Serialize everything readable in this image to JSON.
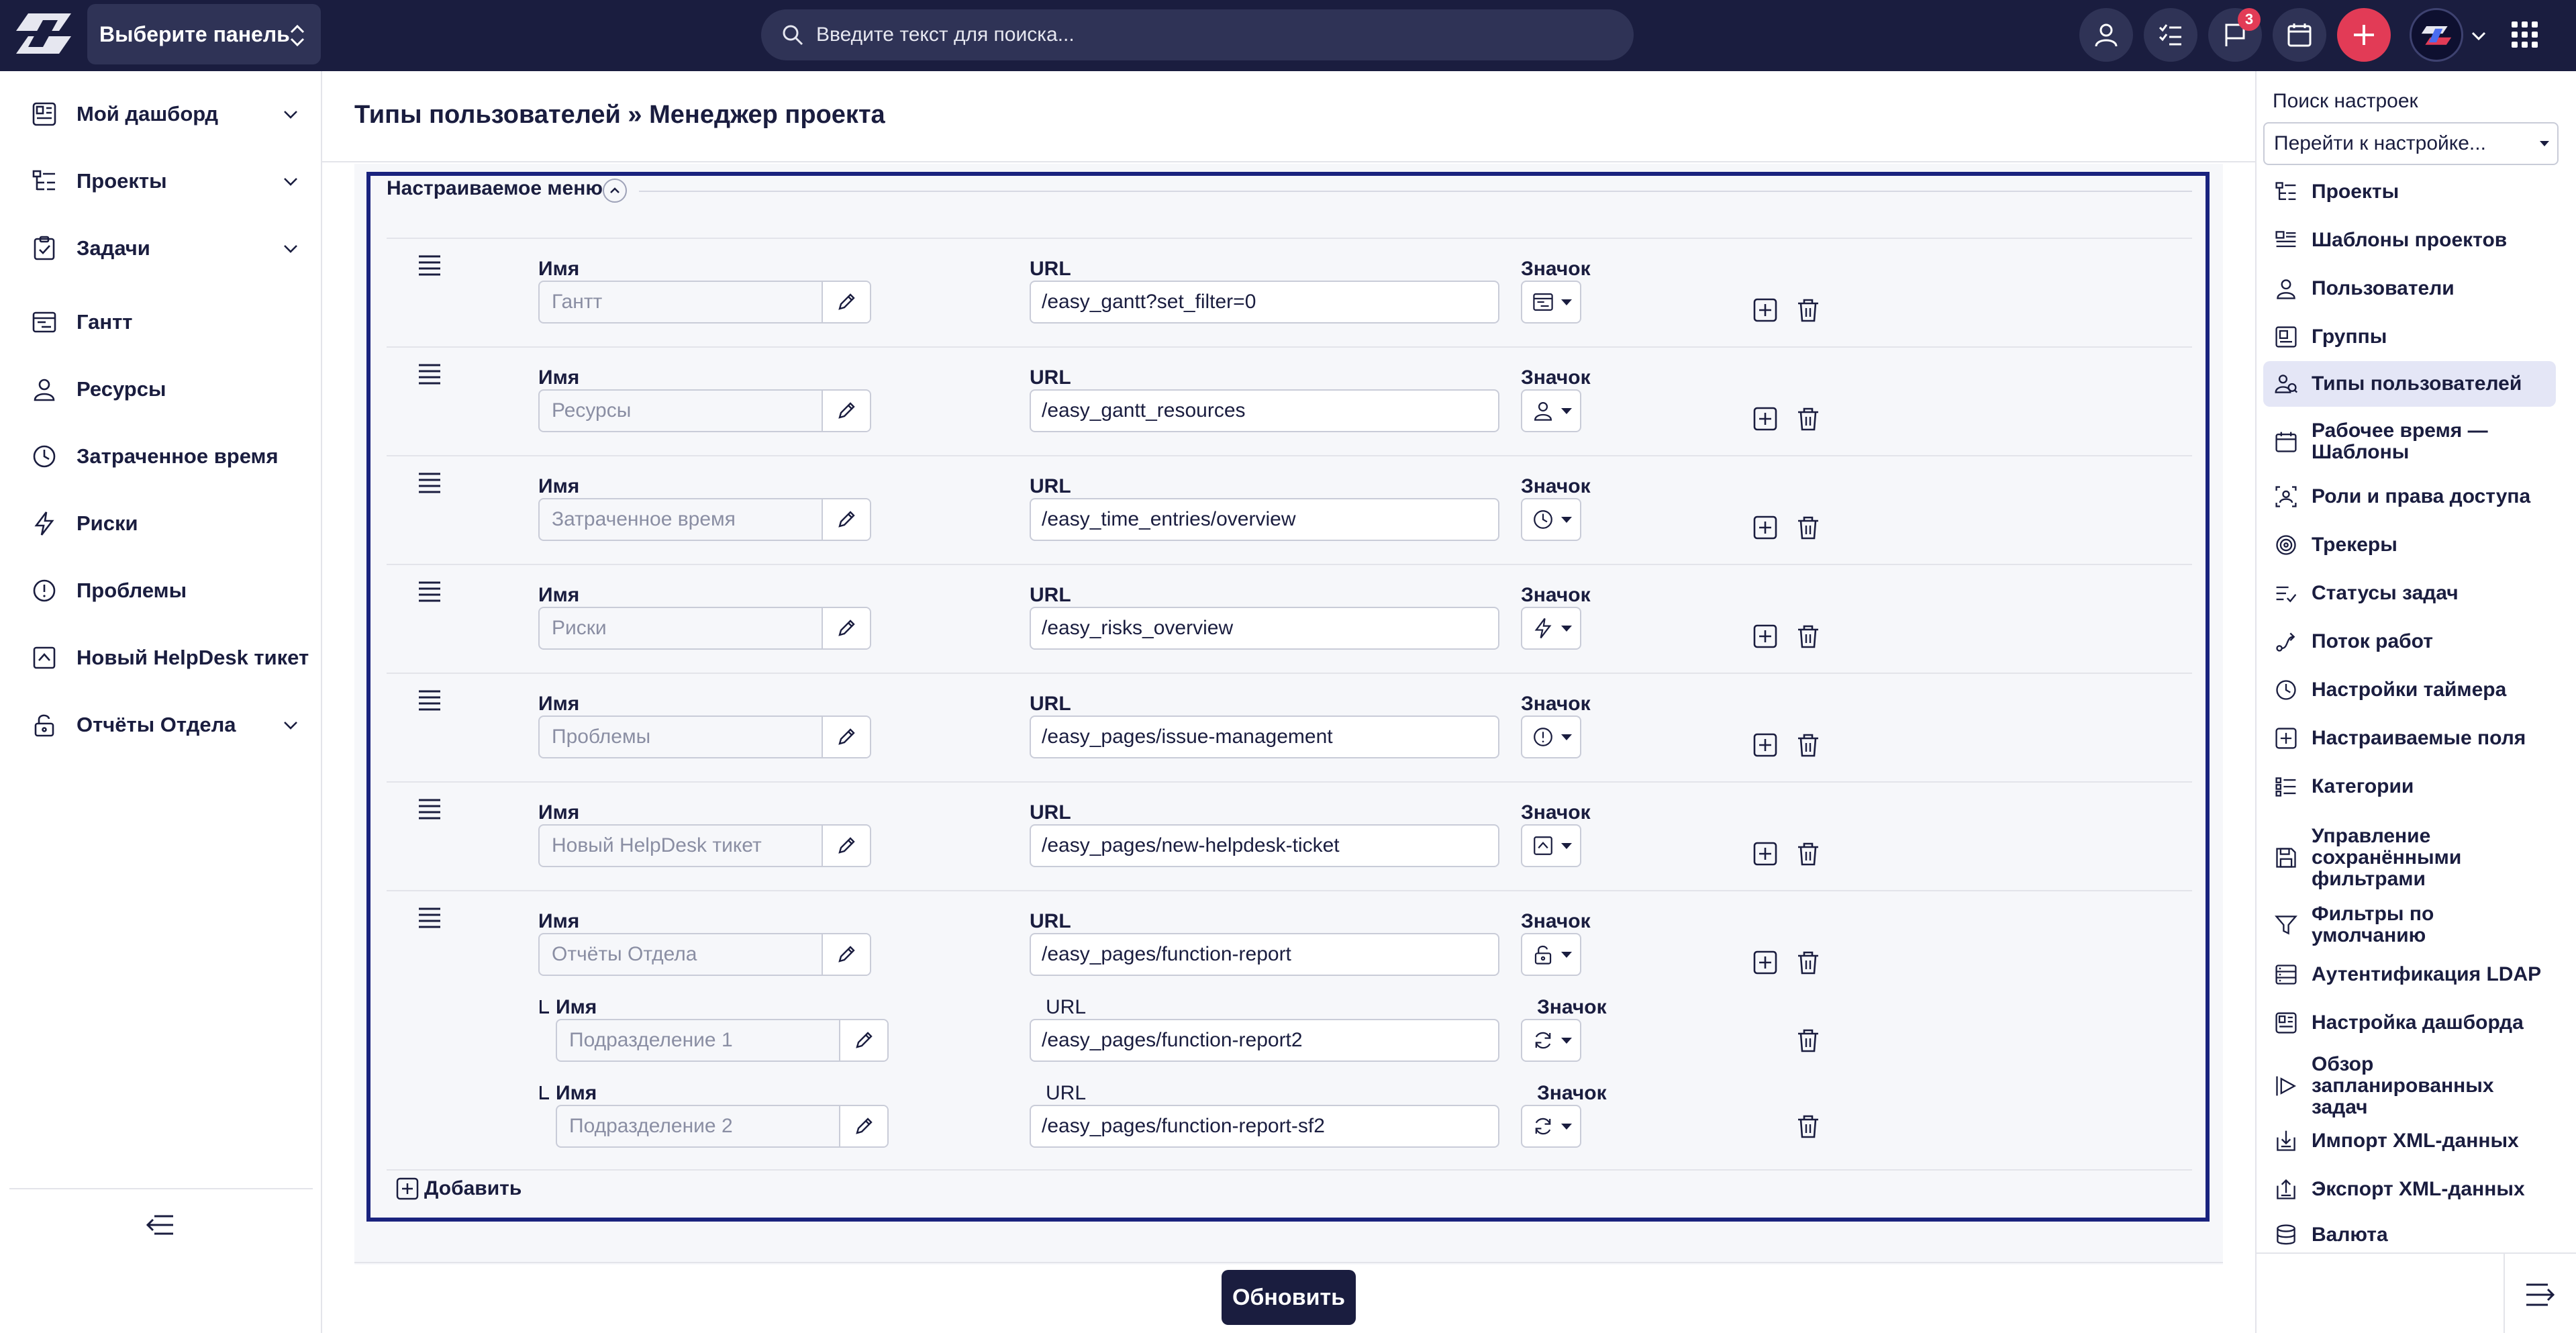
{
  "topbar": {
    "panel_select_label": "Выберите панель",
    "search_placeholder": "Введите текст для поиска...",
    "notifications_count": "3"
  },
  "sidebar": {
    "items": [
      {
        "label": "Мой дашборд",
        "icon": "dashboard-icon",
        "chevron": true
      },
      {
        "label": "Проекты",
        "icon": "projects-icon",
        "chevron": true
      },
      {
        "label": "Задачи",
        "icon": "tasks-icon",
        "chevron": true
      },
      {
        "label": "Гантт",
        "icon": "gantt-icon",
        "chevron": false
      },
      {
        "label": "Ресурсы",
        "icon": "user-icon",
        "chevron": false
      },
      {
        "label": "Затраченное время",
        "icon": "clock-icon",
        "chevron": false
      },
      {
        "label": "Риски",
        "icon": "lightning-icon",
        "chevron": false
      },
      {
        "label": "Проблемы",
        "icon": "alert-icon",
        "chevron": false
      },
      {
        "label": "Новый HelpDesk тикет",
        "icon": "helpdesk-icon",
        "chevron": false
      },
      {
        "label": "Отчёты Отдела",
        "icon": "lock-open-icon",
        "chevron": true
      }
    ]
  },
  "page": {
    "title": "Типы пользователей » Менеджер проекта",
    "section_title": "Настраиваемое меню",
    "name_label": "Имя",
    "url_label": "URL",
    "icon_label": "Значок",
    "add_label": "Добавить",
    "update_label": "Обновить"
  },
  "menu_rows": [
    {
      "name": "Гантт",
      "url": "/easy_gantt?set_filter=0",
      "icon": "gantt-icon"
    },
    {
      "name": "Ресурсы",
      "url": "/easy_gantt_resources",
      "icon": "user-icon"
    },
    {
      "name": "Затраченное время",
      "url": "/easy_time_entries/overview",
      "icon": "clock-icon"
    },
    {
      "name": "Риски",
      "url": "/easy_risks_overview",
      "icon": "lightning-icon"
    },
    {
      "name": "Проблемы",
      "url": "/easy_pages/issue-management",
      "icon": "alert-icon"
    },
    {
      "name": "Новый HelpDesk тикет",
      "url": "/easy_pages/new-helpdesk-ticket",
      "icon": "helpdesk-icon"
    },
    {
      "name": "Отчёты Отдела",
      "url": "/easy_pages/function-report",
      "icon": "lock-open-icon",
      "children": [
        {
          "name": "Подразделение 1",
          "url": "/easy_pages/function-report2",
          "icon": "refresh-icon"
        },
        {
          "name": "Подразделение 2",
          "url": "/easy_pages/function-report-sf2",
          "icon": "refresh-icon"
        }
      ]
    }
  ],
  "right_panel": {
    "search_title": "Поиск настроек",
    "select_value": "Перейти к настройке...",
    "items": [
      {
        "label": "Проекты",
        "icon": "projects-icon"
      },
      {
        "label": "Шаблоны проектов",
        "icon": "template-icon"
      },
      {
        "label": "Пользователи",
        "icon": "user-icon"
      },
      {
        "label": "Группы",
        "icon": "groups-icon"
      },
      {
        "label": "Типы пользователей",
        "icon": "user-types-icon",
        "active": true
      },
      {
        "label": "Рабочее время — Шаблоны",
        "icon": "calendar-icon"
      },
      {
        "label": "Роли и права доступа",
        "icon": "roles-icon"
      },
      {
        "label": "Трекеры",
        "icon": "tracker-icon"
      },
      {
        "label": "Статусы задач",
        "icon": "status-icon"
      },
      {
        "label": "Поток работ",
        "icon": "workflow-icon"
      },
      {
        "label": "Настройки таймера",
        "icon": "clock-icon"
      },
      {
        "label": "Настраиваемые поля",
        "icon": "plus-box-icon"
      },
      {
        "label": "Категории",
        "icon": "categories-icon"
      },
      {
        "label": "Управление сохранёнными фильтрами",
        "icon": "save-icon"
      },
      {
        "label": "Фильтры по умолчанию",
        "icon": "filter-icon"
      },
      {
        "label": "Аутентификация LDAP",
        "icon": "ldap-icon"
      },
      {
        "label": "Настройка дашборда",
        "icon": "dashboard-icon"
      },
      {
        "label": "Обзор запланированных задач",
        "icon": "play-icon"
      },
      {
        "label": "Импорт XML-данных",
        "icon": "import-icon"
      },
      {
        "label": "Экспорт XML-данных",
        "icon": "export-icon"
      },
      {
        "label": "Валюта",
        "icon": "currency-icon"
      }
    ]
  }
}
